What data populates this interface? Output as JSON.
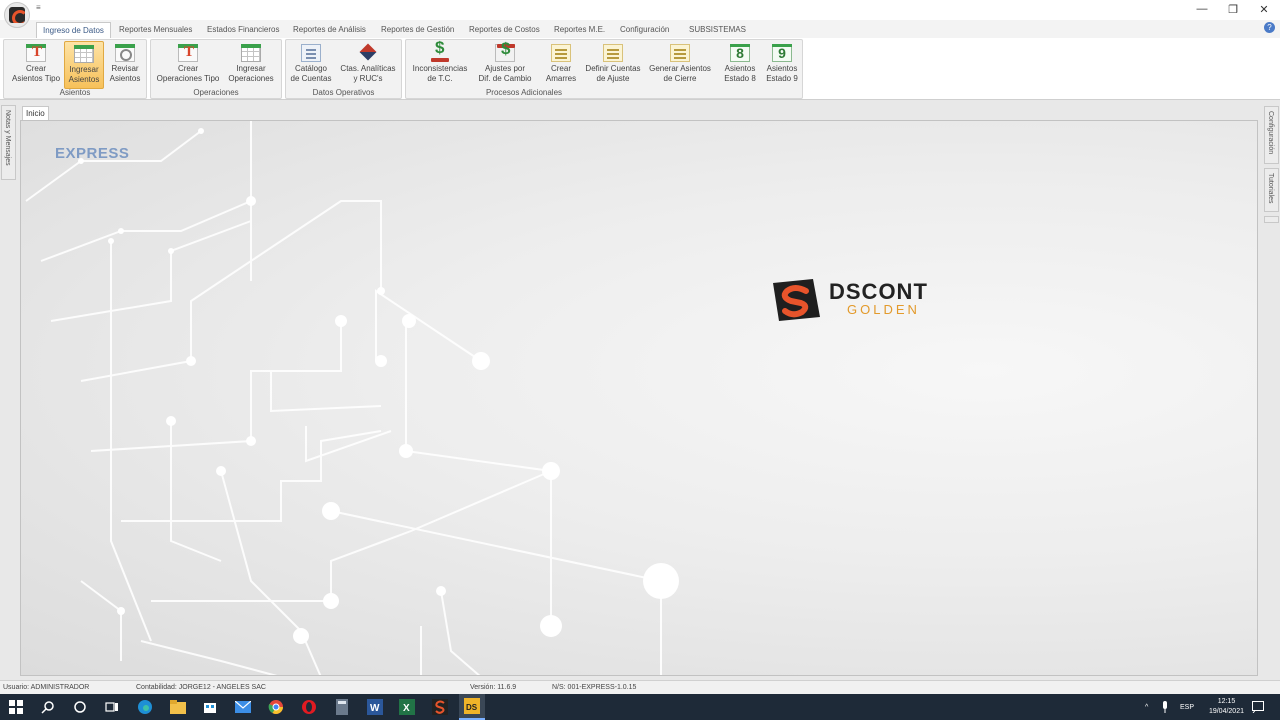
{
  "window": {
    "qat_symbol": "≡",
    "minimize": "—",
    "maximize": "❐",
    "close": "✕"
  },
  "tabs": [
    "Ingreso de Datos",
    "Reportes Mensuales",
    "Estados Financieros",
    "Reportes de Análisis",
    "Reportes de Gestión",
    "Reportes de Costos",
    "Reportes M.E.",
    "Configuración",
    "SUBSISTEMAS"
  ],
  "help_icon": "?",
  "ribbon": {
    "groups": [
      {
        "label": "Asientos",
        "buttons": [
          {
            "line1": "Crear",
            "line2": "Asientos Tipo",
            "icon": "template-t-icon"
          },
          {
            "line1": "Ingresar",
            "line2": "Asientos",
            "icon": "grid-sheet-icon"
          },
          {
            "line1": "Revisar",
            "line2": "Asientos",
            "icon": "search-sheet-icon"
          }
        ]
      },
      {
        "label": "Operaciones",
        "buttons": [
          {
            "line1": "Crear",
            "line2": "Operaciones Tipo",
            "icon": "template-t-icon"
          },
          {
            "line1": "Ingresar",
            "line2": "Operaciones",
            "icon": "grid-sheet-icon"
          }
        ]
      },
      {
        "label": "Datos Operativos",
        "buttons": [
          {
            "line1": "Catálogo",
            "line2": "de Cuentas",
            "icon": "catalog-icon"
          },
          {
            "line1": "Ctas. Analíticas",
            "line2": "y RUC's",
            "icon": "diamond-icon"
          }
        ]
      },
      {
        "label": "Procesos Adicionales",
        "buttons": [
          {
            "line1": "Inconsistencias",
            "line2": "de T.C.",
            "icon": "money-warning-icon"
          },
          {
            "line1": "Ajustes por",
            "line2": "Dif. de Cambio",
            "icon": "money-sheet-icon"
          },
          {
            "line1": "Crear",
            "line2": "Amarres",
            "icon": "yellow-sheet-icon"
          },
          {
            "line1": "Definir Cuentas",
            "line2": "de Ajuste",
            "icon": "yellow-sheet-icon"
          },
          {
            "line1": "Generar Asientos",
            "line2": "de Cierre",
            "icon": "yellow-sheet-icon"
          },
          {
            "line1": "Asientos",
            "line2": "Estado 8",
            "icon": "number-8-icon",
            "num": "8"
          },
          {
            "line1": "Asientos",
            "line2": "Estado 9",
            "icon": "number-9-icon",
            "num": "9"
          }
        ]
      }
    ]
  },
  "side_panels": {
    "left": "Notas y Mensajes",
    "right_top": "Configuración",
    "right_bottom": "Tutoriales"
  },
  "doc_tab": "Inicio",
  "splash": {
    "edition": "EXPRESS",
    "brand_name": "DSCONT",
    "brand_sub": "GOLDEN"
  },
  "status": {
    "user": "Usuario: ADMINISTRADOR",
    "company": "Contabilidad: JORGE12 - ANGELES SAC",
    "version": "Versión: 11.6.9",
    "serial": "N/S: 001-EXPRESS-1.0.15"
  },
  "taskbar": {
    "lang": "ESP",
    "time": "12:15",
    "date": "19/04/2021"
  },
  "colors": {
    "accent_blue": "#3b5a86",
    "brand_orange": "#e8542b",
    "brand_gold": "#e39a2b"
  }
}
